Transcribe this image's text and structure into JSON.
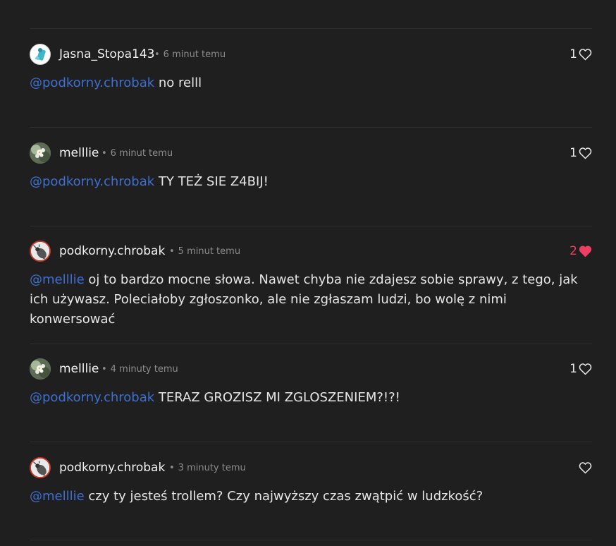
{
  "comments": [
    {
      "author": "Jasna_Stopa143",
      "time": "6 minut temu",
      "mention": "@podkorny.chrobak",
      "text": " no relll",
      "likes": "1",
      "liked": false,
      "avatar": "blue-figure-avatar"
    },
    {
      "author": "melllie",
      "time": "6 minut temu",
      "mention": "@podkorny.chrobak",
      "text": " TY TEŻ SIE Z4BIJ!",
      "likes": "1",
      "liked": false,
      "avatar": "flower-photo-avatar"
    },
    {
      "author": "podkorny.chrobak",
      "time": "5 minut temu",
      "mention": "@melllie",
      "text": " oj to bardzo mocne słowa. Nawet chyba nie zdajesz sobie sprawy, z tego, jak ich używasz. Poleciałoby zgłoszonko, ale nie zgłaszam ludzi, bo wolę z nimi konwersować",
      "likes": "2",
      "liked": true,
      "avatar": "beetle-avatar"
    },
    {
      "author": "melllie",
      "time": "4 minuty temu",
      "mention": "@podkorny.chrobak",
      "text": " TERAZ GROZISZ MI ZGLOSZENIEM?!?!",
      "likes": "1",
      "liked": false,
      "avatar": "flower-photo-avatar"
    },
    {
      "author": "podkorny.chrobak",
      "time": "3 minuty temu",
      "mention": "@melllie",
      "text": " czy ty jesteś trollem? Czy najwyższy czas zwątpić w ludzkość?",
      "likes": "",
      "liked": false,
      "avatar": "beetle-avatar"
    }
  ],
  "separator": "•",
  "colors": {
    "background": "#1f1f1f",
    "mention": "#3e6fd1",
    "liked_heart": "#ee3e63",
    "meta_text": "#8d8d8d"
  }
}
